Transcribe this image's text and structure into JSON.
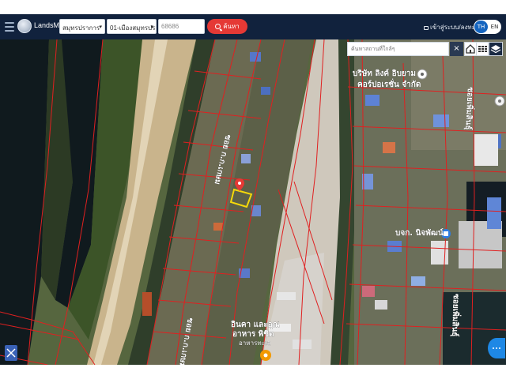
{
  "app": {
    "name": "LandsMaps"
  },
  "header": {
    "province_select": "สมุทรปราการ",
    "district_select": "01-เมืองสมุทรปราการ",
    "parcel_input_value": "68686",
    "search_label": "ค้นหา",
    "login_label": "เข้าสู่ระบบ/ลงทะเบียน",
    "lang_th": "TH",
    "lang_en": "EN"
  },
  "map": {
    "place_search_placeholder": "ค้นหาสถานที่ใกล้ๆ",
    "clear_label": "×",
    "labels": {
      "company_top_line1": "บริษัท ลิงค์ อิบยาม",
      "company_top_line2": "คอร์ปอเรชั่น จำกัด",
      "company_mid": "บจก. นิจพัฒน์",
      "place_bottom_line1": "อินคา และอุณ",
      "place_bottom_line2": "อาหาร พิชิต",
      "place_bottom_line3": "อาหารทะเล",
      "road_left_top": "ซอย ก.ก.เกษม",
      "road_left_bottom": "ซอย ก.ก.เกษม",
      "road_right": "ซอยเพิ่มสินธุ์",
      "road_right_bottom": "ซอยเพิ่มสินธุ์"
    },
    "colors": {
      "parcel_lines": "#e02020",
      "selected_parcel": "#f5d90a",
      "marker": "#e53935",
      "header_bg": "#11223d",
      "accent_blue": "#1e88e5"
    },
    "icons": {
      "marker": "map-pin-icon",
      "home": "home-icon",
      "grid": "grid-icon",
      "layers": "layers-icon",
      "fullscreen": "expand-icon",
      "more": "more-dots-icon"
    }
  }
}
